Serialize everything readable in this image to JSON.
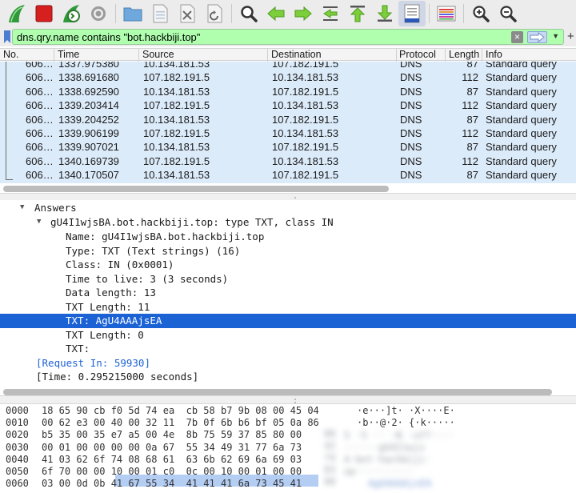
{
  "toolbar": {
    "buttons": [
      {
        "icon": "shark-fin-start-icon"
      },
      {
        "icon": "stop-square-icon"
      },
      {
        "icon": "restart-capture-icon"
      },
      {
        "icon": "capture-options-gear-icon"
      },
      {
        "icon": "open-folder-icon"
      },
      {
        "icon": "save-file-icon"
      },
      {
        "icon": "close-file-icon"
      },
      {
        "icon": "reload-file-icon"
      },
      {
        "icon": "find-packet-icon"
      },
      {
        "icon": "go-back-arrow-icon"
      },
      {
        "icon": "go-forward-arrow-icon"
      },
      {
        "icon": "go-to-packet-icon"
      },
      {
        "icon": "go-first-packet-icon"
      },
      {
        "icon": "go-last-packet-icon"
      },
      {
        "icon": "auto-scroll-icon"
      },
      {
        "icon": "colorize-icon"
      },
      {
        "icon": "zoom-in-icon"
      },
      {
        "icon": "zoom-out-icon"
      }
    ]
  },
  "filter": {
    "value": "dns.qry.name contains \"bot.hackbiji.top\"",
    "color": "#afffaf"
  },
  "packet_list": {
    "columns": [
      "No.",
      "Time",
      "Source",
      "Destination",
      "Protocol",
      "Length",
      "Info"
    ],
    "rows": [
      {
        "no": "606…",
        "time": "1337.975380",
        "src": "10.134.181.53",
        "dst": "107.182.191.5",
        "proto": "DNS",
        "len": "87",
        "info": "Standard query"
      },
      {
        "no": "606…",
        "time": "1338.691680",
        "src": "107.182.191.5",
        "dst": "10.134.181.53",
        "proto": "DNS",
        "len": "112",
        "info": "Standard query"
      },
      {
        "no": "606…",
        "time": "1338.692590",
        "src": "10.134.181.53",
        "dst": "107.182.191.5",
        "proto": "DNS",
        "len": "87",
        "info": "Standard query"
      },
      {
        "no": "606…",
        "time": "1339.203414",
        "src": "107.182.191.5",
        "dst": "10.134.181.53",
        "proto": "DNS",
        "len": "112",
        "info": "Standard query"
      },
      {
        "no": "606…",
        "time": "1339.204252",
        "src": "10.134.181.53",
        "dst": "107.182.191.5",
        "proto": "DNS",
        "len": "87",
        "info": "Standard query"
      },
      {
        "no": "606…",
        "time": "1339.906199",
        "src": "107.182.191.5",
        "dst": "10.134.181.53",
        "proto": "DNS",
        "len": "112",
        "info": "Standard query"
      },
      {
        "no": "606…",
        "time": "1339.907021",
        "src": "10.134.181.53",
        "dst": "107.182.191.5",
        "proto": "DNS",
        "len": "87",
        "info": "Standard query"
      },
      {
        "no": "606…",
        "time": "1340.169739",
        "src": "107.182.191.5",
        "dst": "10.134.181.53",
        "proto": "DNS",
        "len": "112",
        "info": "Standard query"
      },
      {
        "no": "606…",
        "time": "1340.170507",
        "src": "10.134.181.53",
        "dst": "107.182.191.5",
        "proto": "DNS",
        "len": "87",
        "info": "Standard query"
      }
    ]
  },
  "details": {
    "answers_label": "Answers",
    "record": "gU4I1wjsBA.bot.hackbiji.top: type TXT, class IN",
    "fields": [
      "Name: gU4I1wjsBA.bot.hackbiji.top",
      "Type: TXT (Text strings) (16)",
      "Class: IN (0x0001)",
      "Time to live: 3 (3 seconds)",
      "Data length: 13",
      "TXT Length: 11",
      "TXT: AgU4AAAjsEA",
      "TXT Length: 0",
      "TXT:"
    ],
    "request_in": "[Request In: 59930]",
    "time": "[Time: 0.295215000 seconds]"
  },
  "bytes": {
    "rows": [
      {
        "offset": "0000",
        "hex": "18 65 90 cb f0 5d 74 ea  cb 58 b7 9b 08 00 45 04",
        "ascii": "·e···]t· ·X····E·"
      },
      {
        "offset": "0010",
        "hex": "00 62 e3 00 40 00 32 11  7b 0f 6b b6 bf 05 0a 86",
        "ascii": "·b··@·2· {·k·····"
      },
      {
        "offset": "0020",
        "hex": "b5 35 00 35 e7 a5 00 4e  8b 75 59 37 85 80 00",
        "ascii": ""
      },
      {
        "offset": "0030",
        "hex": "00 01 00 00 00 00 0a 67  55 34 49 31 77 6a 73",
        "ascii": ""
      },
      {
        "offset": "0040",
        "hex": "41 03 62 6f 74 08 68 61  63 6b 62 69 6a 69 03",
        "ascii": ""
      },
      {
        "offset": "0050",
        "hex": "6f 70 00 00 10 00 01 c0  0c 00 10 00 01 00 00",
        "ascii": ""
      },
      {
        "offset": "0060",
        "hex": "03 00 0d 0b 41 67 55 34  41 41 41 6a 73 45 41",
        "ascii": ""
      }
    ]
  }
}
